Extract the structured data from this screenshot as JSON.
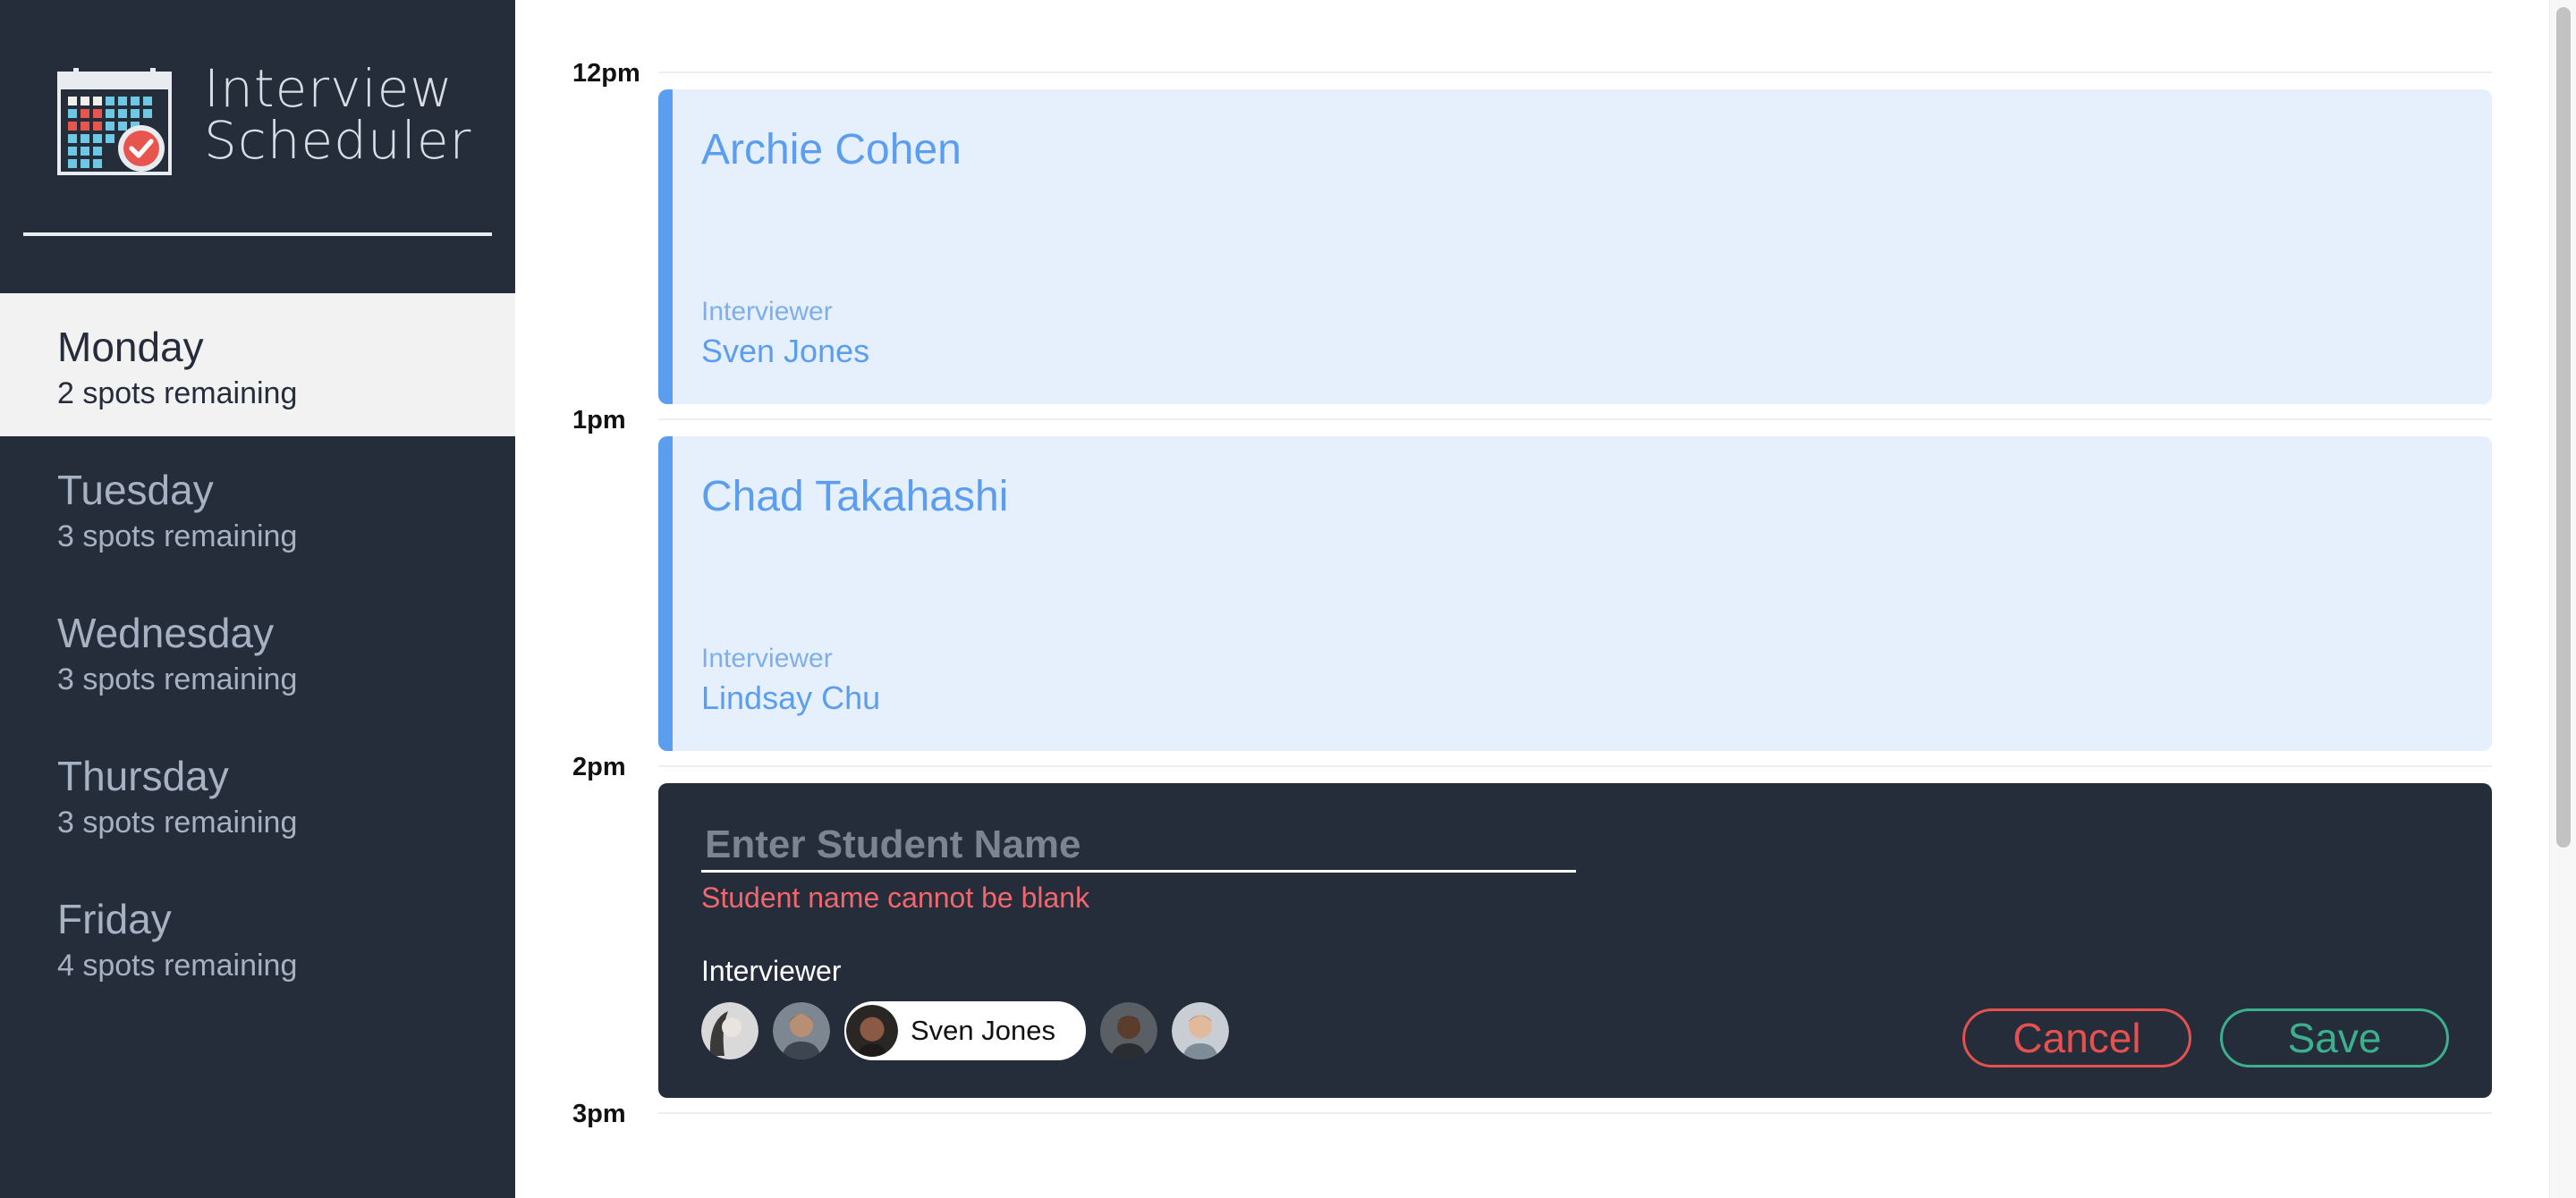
{
  "brand": {
    "title_line1": "Interview",
    "title_line2": "Scheduler",
    "logo_icon": "calendar-check-icon"
  },
  "sidebar": {
    "days": [
      {
        "name": "Monday",
        "spots": "2 spots remaining",
        "selected": true
      },
      {
        "name": "Tuesday",
        "spots": "3 spots remaining",
        "selected": false
      },
      {
        "name": "Wednesday",
        "spots": "3 spots remaining",
        "selected": false
      },
      {
        "name": "Thursday",
        "spots": "3 spots remaining",
        "selected": false
      },
      {
        "name": "Friday",
        "spots": "4 spots remaining",
        "selected": false
      }
    ]
  },
  "schedule": {
    "times": [
      "12pm",
      "1pm",
      "2pm",
      "3pm"
    ],
    "appointments": [
      {
        "student": "Archie Cohen",
        "interviewer_label": "Interviewer",
        "interviewer": "Sven Jones"
      },
      {
        "student": "Chad Takahashi",
        "interviewer_label": "Interviewer",
        "interviewer": "Lindsay Chu"
      }
    ],
    "form": {
      "name_placeholder": "Enter Student Name",
      "name_value": "",
      "error": "Student name cannot be blank",
      "interviewer_label": "Interviewer",
      "selected_interviewer": "Sven Jones",
      "cancel_label": "Cancel",
      "save_label": "Save"
    }
  },
  "colors": {
    "sidebar_bg": "#252d3b",
    "appointment_bg": "#e6f0fd",
    "appointment_accent": "#5b9def",
    "error": "#f2676e",
    "cancel": "#e5514f",
    "save": "#3cb08c"
  }
}
